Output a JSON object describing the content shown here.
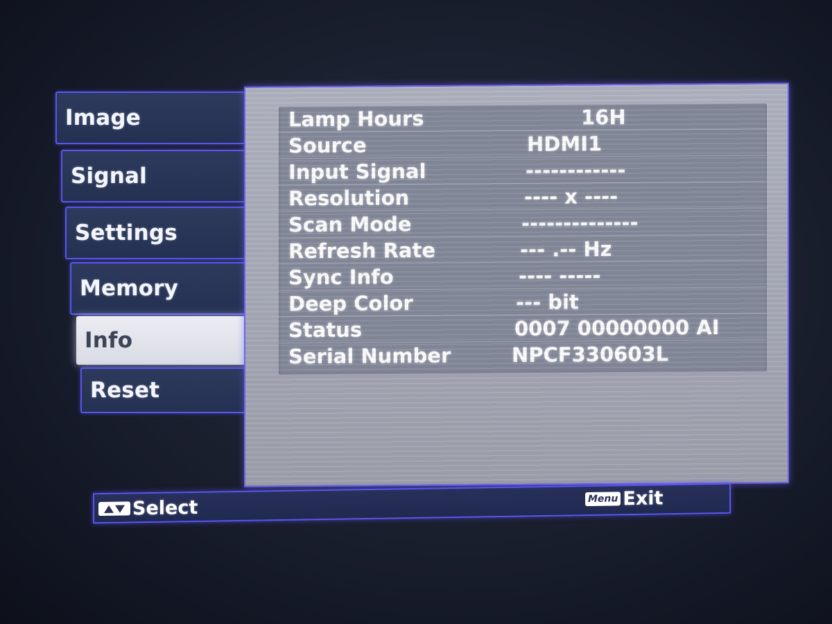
{
  "sidebar": {
    "items": [
      {
        "label": "Image",
        "active": false
      },
      {
        "label": "Signal",
        "active": false
      },
      {
        "label": "Settings",
        "active": false
      },
      {
        "label": "Memory",
        "active": false
      },
      {
        "label": "Info",
        "active": true
      },
      {
        "label": "Reset",
        "active": false
      }
    ]
  },
  "info": {
    "rows": [
      {
        "label": "Lamp Hours",
        "value": "16H"
      },
      {
        "label": "Source",
        "value": "HDMI1"
      },
      {
        "label": "Input Signal",
        "value": "------------"
      },
      {
        "label": "Resolution",
        "value": "----   x ----"
      },
      {
        "label": "Scan Mode",
        "value": "--------------"
      },
      {
        "label": "Refresh Rate",
        "value": "---  .-- Hz"
      },
      {
        "label": "Sync Info",
        "value": "----   -----"
      },
      {
        "label": "Deep Color",
        "value": "--- bit"
      },
      {
        "label": "Status",
        "value": "0007 00000000 AI"
      },
      {
        "label": "Serial Number",
        "value": "NPCF330603L"
      }
    ]
  },
  "footer": {
    "select_label": "Select",
    "exit_key": "Menu",
    "exit_label": "Exit"
  },
  "colors": {
    "accent_border": "#5a55f0",
    "panel_bg": "#aeb1be",
    "table_bg": "#858a9b",
    "tab_bg": "#2b375a",
    "active_tab_bg": "#e6e7ee"
  },
  "icons": {
    "select_key": "up-down-arrows-icon",
    "exit_key": "menu-key-icon"
  }
}
